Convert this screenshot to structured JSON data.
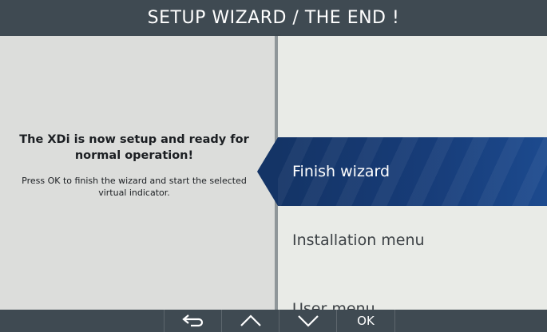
{
  "header": {
    "title": "SETUP WIZARD / THE END !"
  },
  "info": {
    "message": "The XDi is now setup and ready for normal operation!",
    "hint": "Press OK to finish the wizard and start the selected virtual indicator."
  },
  "menu": {
    "items": [
      {
        "label": "Finish wizard",
        "selected": true
      },
      {
        "label": "Installation menu",
        "selected": false
      },
      {
        "label": "User menu",
        "selected": false
      }
    ]
  },
  "softkeys": [
    {
      "icon": "back-arrow-icon"
    },
    {
      "icon": "chevron-up-icon"
    },
    {
      "icon": "chevron-down-icon"
    },
    {
      "label": "OK"
    }
  ],
  "colors": {
    "titlebar": "#3f4a52",
    "selected": "#173c78",
    "left_panel": "#dcdddb",
    "right_panel": "#e9ebe7"
  }
}
